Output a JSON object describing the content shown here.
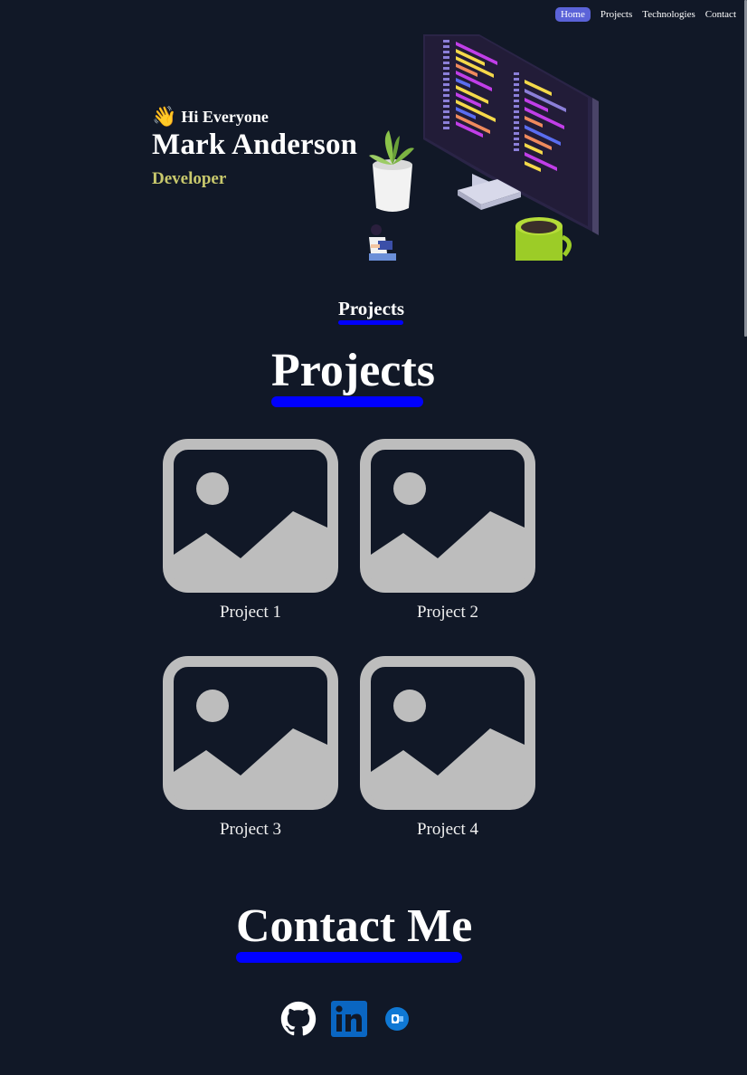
{
  "nav": {
    "items": [
      "Home",
      "Projects",
      "Technologies",
      "Contact"
    ],
    "active": "Home"
  },
  "hero": {
    "greeting": "Hi Everyone",
    "name": "Mark Anderson",
    "role": "Developer"
  },
  "projects_label": "Projects",
  "projects_heading": "Projects",
  "projects": [
    {
      "label": "Project 1"
    },
    {
      "label": "Project 2"
    },
    {
      "label": "Project 3"
    },
    {
      "label": "Project 4"
    }
  ],
  "contact_heading": "Contact Me",
  "socials": [
    {
      "icon": "github-icon"
    },
    {
      "icon": "linkedin-icon"
    },
    {
      "icon": "outlook-icon"
    }
  ],
  "colors": {
    "background": "#111827",
    "accent_bar": "#0000ff",
    "nav_active": "#5b63d8",
    "role_text": "#c8c86c",
    "placeholder_image": "#bdbdbd"
  }
}
